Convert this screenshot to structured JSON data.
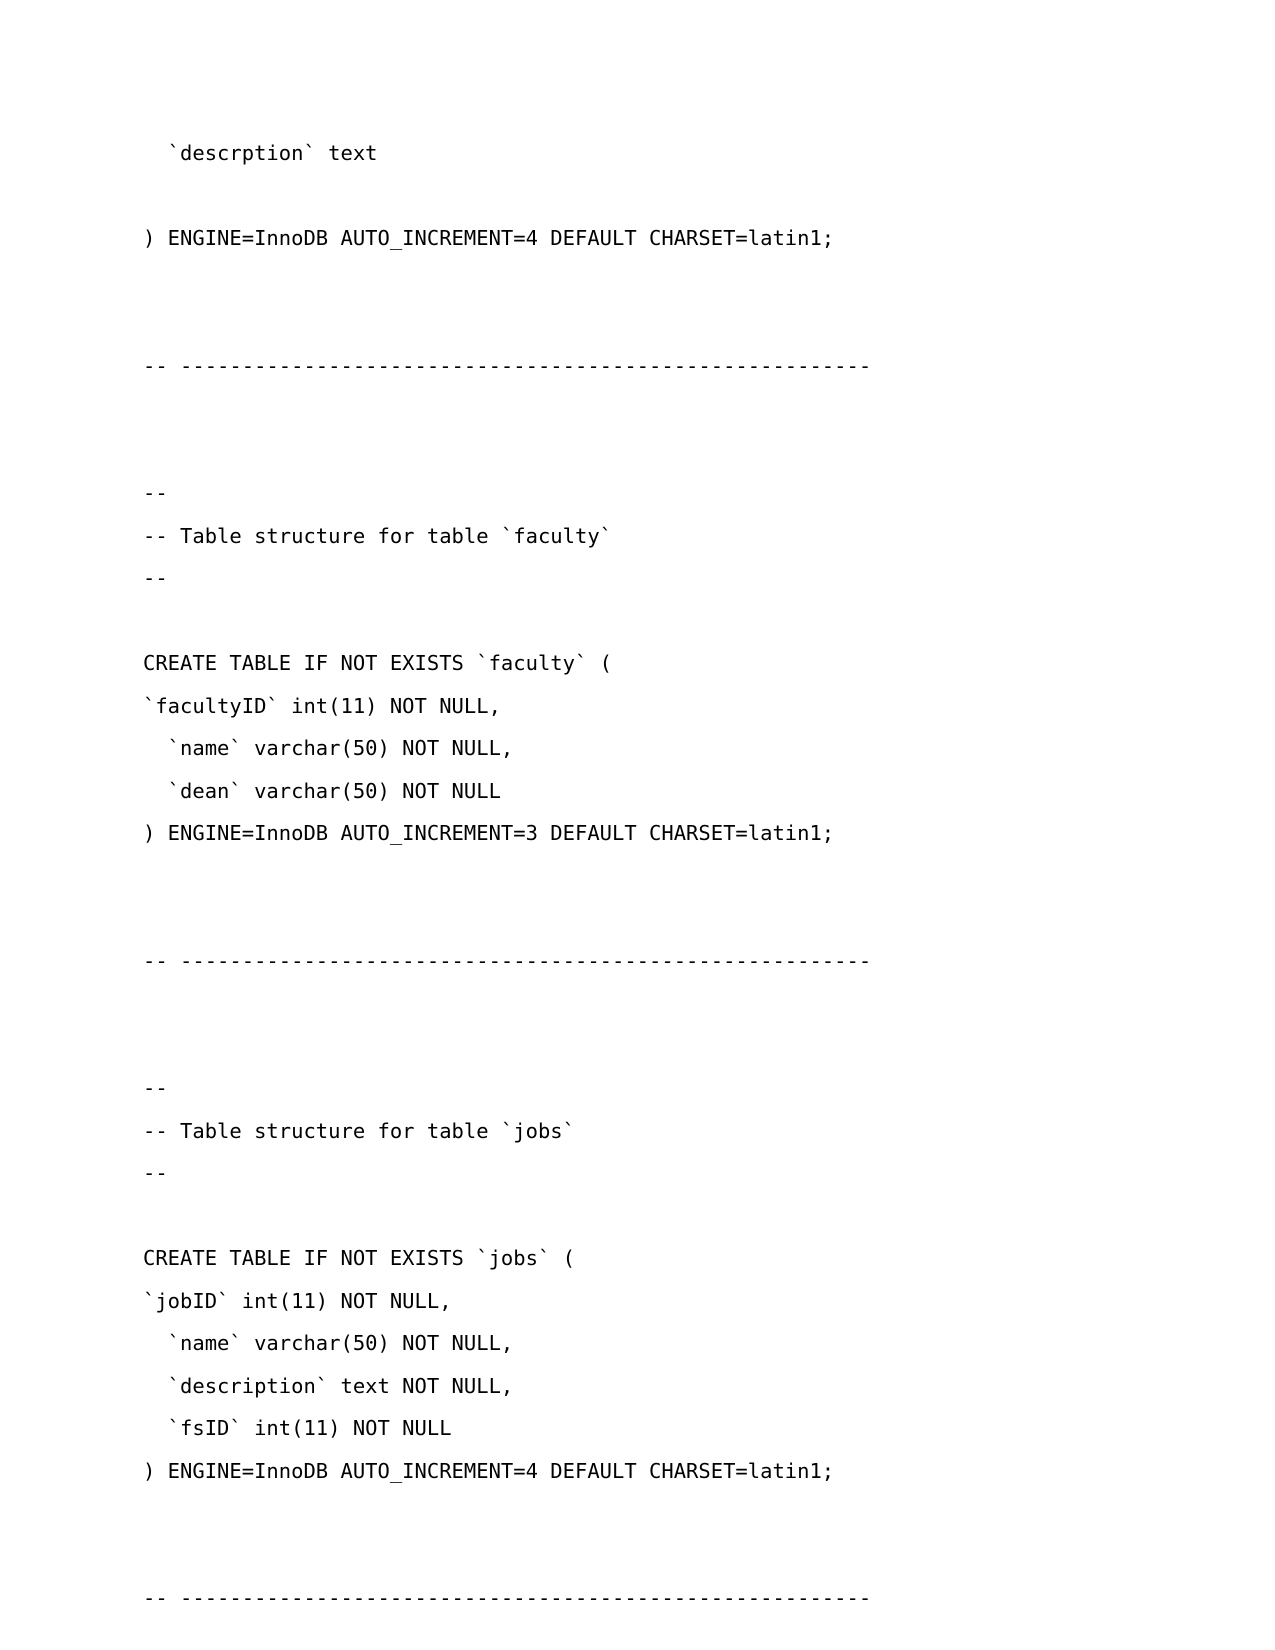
{
  "document": {
    "type": "sql-dump-listing",
    "page_background": "#ffffff",
    "text_color": "#000000",
    "lines": [
      {
        "id": "l01",
        "kind": "code",
        "text": "  `descrption` text"
      },
      {
        "id": "l02",
        "kind": "blank",
        "text": ""
      },
      {
        "id": "l03",
        "kind": "code",
        "text": ") ENGINE=InnoDB AUTO_INCREMENT=4 DEFAULT CHARSET=latin1;"
      },
      {
        "id": "l04",
        "kind": "blank",
        "text": ""
      },
      {
        "id": "l05",
        "kind": "blank",
        "text": ""
      },
      {
        "id": "l06",
        "kind": "separator",
        "text": "-- --------------------------------------------------------"
      },
      {
        "id": "l07",
        "kind": "blank",
        "text": ""
      },
      {
        "id": "l08",
        "kind": "blank",
        "text": ""
      },
      {
        "id": "l09",
        "kind": "code",
        "text": "--"
      },
      {
        "id": "l10",
        "kind": "code",
        "text": "-- Table structure for table `faculty`"
      },
      {
        "id": "l11",
        "kind": "code",
        "text": "--"
      },
      {
        "id": "l12",
        "kind": "blank",
        "text": ""
      },
      {
        "id": "l13",
        "kind": "code",
        "text": "CREATE TABLE IF NOT EXISTS `faculty` ("
      },
      {
        "id": "l14",
        "kind": "code",
        "text": "`facultyID` int(11) NOT NULL,"
      },
      {
        "id": "l15",
        "kind": "code",
        "text": "  `name` varchar(50) NOT NULL,"
      },
      {
        "id": "l16",
        "kind": "code",
        "text": "  `dean` varchar(50) NOT NULL"
      },
      {
        "id": "l17",
        "kind": "code",
        "text": ") ENGINE=InnoDB AUTO_INCREMENT=3 DEFAULT CHARSET=latin1;"
      },
      {
        "id": "l18",
        "kind": "blank",
        "text": ""
      },
      {
        "id": "l19",
        "kind": "blank",
        "text": ""
      },
      {
        "id": "l20",
        "kind": "separator",
        "text": "-- --------------------------------------------------------"
      },
      {
        "id": "l21",
        "kind": "blank",
        "text": ""
      },
      {
        "id": "l22",
        "kind": "blank",
        "text": ""
      },
      {
        "id": "l23",
        "kind": "code",
        "text": "--"
      },
      {
        "id": "l24",
        "kind": "code",
        "text": "-- Table structure for table `jobs`"
      },
      {
        "id": "l25",
        "kind": "code",
        "text": "--"
      },
      {
        "id": "l26",
        "kind": "blank",
        "text": ""
      },
      {
        "id": "l27",
        "kind": "code",
        "text": "CREATE TABLE IF NOT EXISTS `jobs` ("
      },
      {
        "id": "l28",
        "kind": "code",
        "text": "`jobID` int(11) NOT NULL,"
      },
      {
        "id": "l29",
        "kind": "code",
        "text": "  `name` varchar(50) NOT NULL,"
      },
      {
        "id": "l30",
        "kind": "code",
        "text": "  `description` text NOT NULL,"
      },
      {
        "id": "l31",
        "kind": "code",
        "text": "  `fsID` int(11) NOT NULL"
      },
      {
        "id": "l32",
        "kind": "code",
        "text": ") ENGINE=InnoDB AUTO_INCREMENT=4 DEFAULT CHARSET=latin1;"
      },
      {
        "id": "l33",
        "kind": "blank",
        "text": ""
      },
      {
        "id": "l34",
        "kind": "blank",
        "text": ""
      },
      {
        "id": "l35",
        "kind": "separator",
        "text": "-- --------------------------------------------------------"
      }
    ]
  }
}
